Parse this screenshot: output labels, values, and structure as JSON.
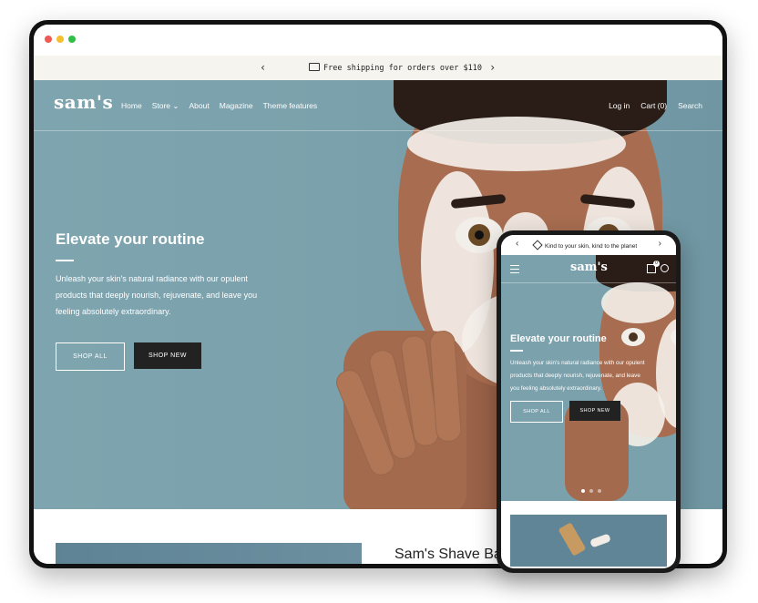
{
  "announcement": {
    "text": "Free shipping for orders over $110",
    "prev_icon": "chevron-left-icon",
    "next_icon": "chevron-right-icon"
  },
  "header": {
    "logo": "sam's",
    "nav": [
      "Home",
      "Store",
      "About",
      "Magazine",
      "Theme features"
    ],
    "store_chevron": "⌄",
    "login": "Log in",
    "cart": "Cart (0)",
    "search": "Search"
  },
  "hero": {
    "title": "Elevate your routine",
    "subtitle_lines": [
      "Unleash your skin's natural radiance with our opulent",
      "products that deeply nourish, rejuvenate, and leave you",
      "feeling absolutely extraordinary."
    ],
    "btn_shop_all": "SHOP ALL",
    "btn_shop_new": "SHOP NEW"
  },
  "below": {
    "title": "Sam's Shave Ba"
  },
  "mobile": {
    "announcement": "Kind to your skin, kind to the planet",
    "logo": "sam's",
    "cart_count": "0",
    "hero_title": "Elevate your routine",
    "subtitle_lines": [
      "Unleash your skin's natural radiance with our opulent",
      "products that deeply nourish, rejuvenate, and leave",
      "you feeling absolutely extraordinary."
    ],
    "btn_shop_all": "SHOP ALL",
    "btn_shop_new": "SHOP NEW"
  },
  "colors": {
    "hero_bg": "#7ba1ac",
    "announce_bg": "#f6f4ef",
    "dark_button": "#222222"
  }
}
